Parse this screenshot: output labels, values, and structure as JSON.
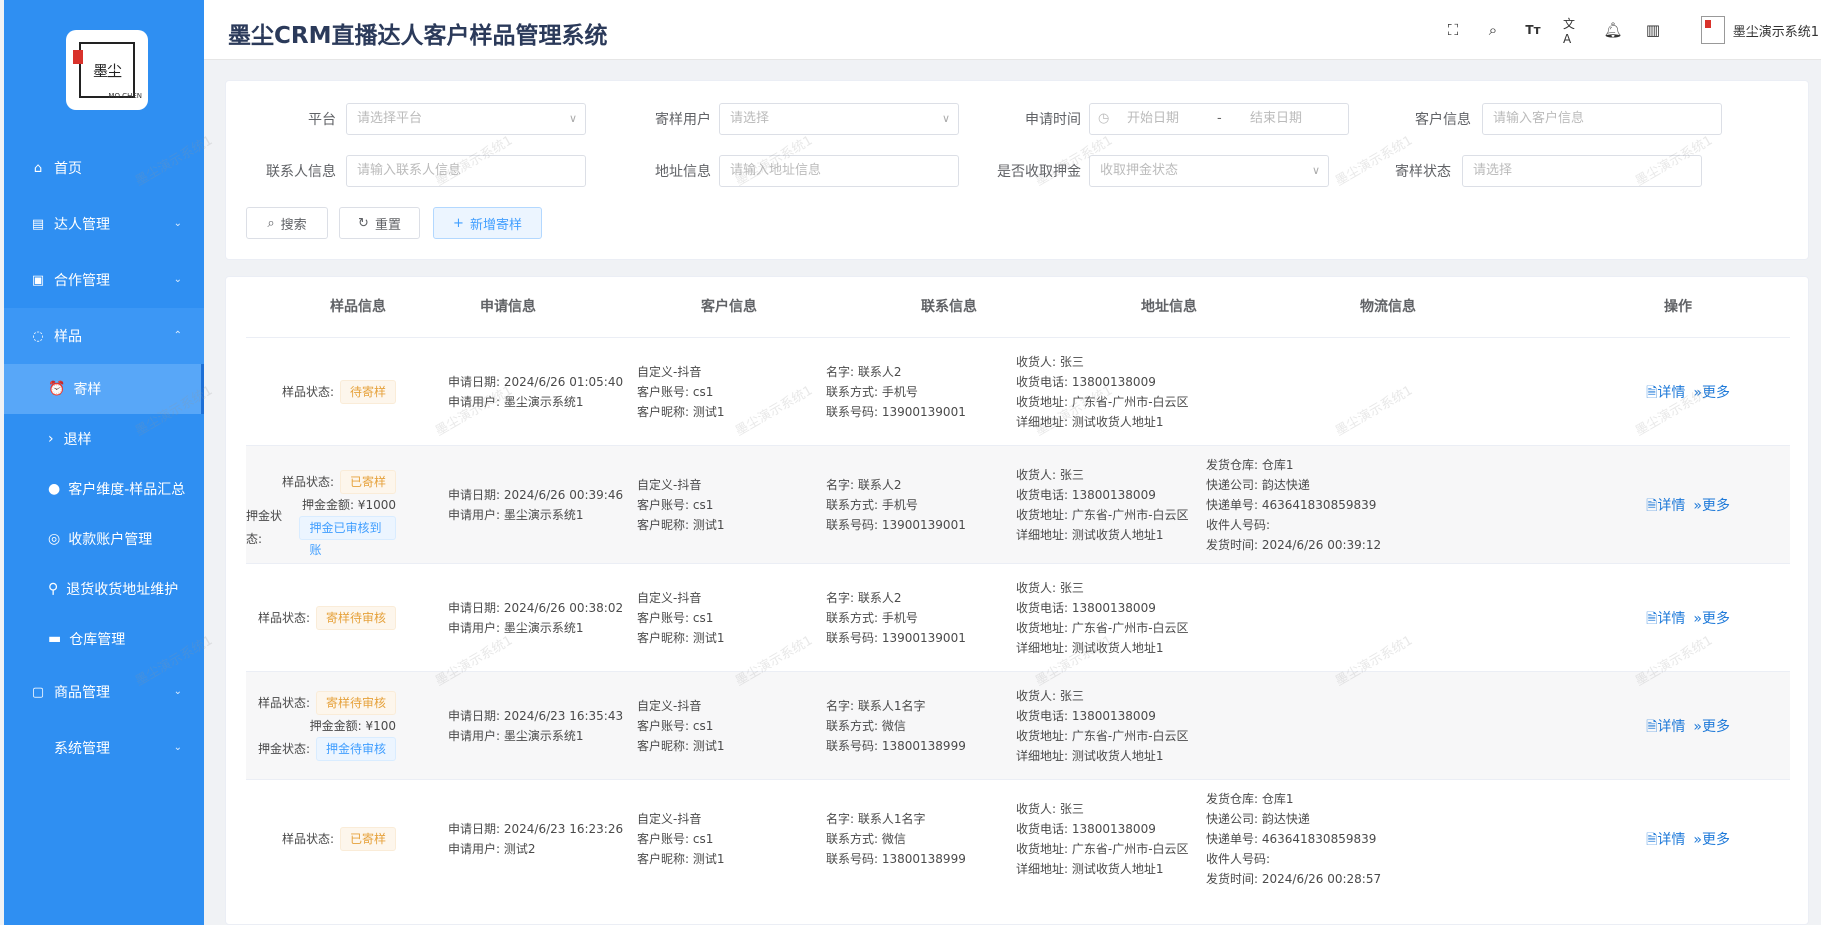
{
  "app_title": "墨尘CRM直播达人客户样品管理系统",
  "user_name": "墨尘演示系统1",
  "logo": {
    "char": "墨尘",
    "sub": "MO CHEN"
  },
  "watermark": "墨尘演示系统1",
  "sidebar": {
    "items": [
      {
        "label": "首页",
        "icon": "home-icon"
      },
      {
        "label": "达人管理",
        "icon": "id-card-icon"
      },
      {
        "label": "合作管理",
        "icon": "briefcase-icon"
      },
      {
        "label": "样品",
        "icon": "apple-icon"
      },
      {
        "label": "寄样",
        "icon": "alarm-clock-icon"
      },
      {
        "label": "退样",
        "icon": "chevron-right-icon"
      },
      {
        "label": "客户维度-样品汇总",
        "icon": "user-icon"
      },
      {
        "label": "收款账户管理",
        "icon": "compass-icon"
      },
      {
        "label": "退货收货地址维护",
        "icon": "bicycle-icon"
      },
      {
        "label": "仓库管理",
        "icon": "suitcase-icon"
      },
      {
        "label": "商品管理",
        "icon": "box-icon"
      },
      {
        "label": "系统管理",
        "icon": ""
      }
    ]
  },
  "filters": {
    "platform_label": "平台",
    "platform_ph": "请选择平台",
    "sender_label": "寄样用户",
    "sender_ph": "请选择",
    "apply_time_label": "申请时间",
    "start_ph": "开始日期",
    "sep": "-",
    "end_ph": "结束日期",
    "customer_label": "客户信息",
    "customer_ph": "请输入客户信息",
    "contact_label": "联系人信息",
    "contact_ph": "请输入联系人信息",
    "address_label": "地址信息",
    "address_ph": "请输入地址信息",
    "deposit_label": "是否收取押金",
    "deposit_ph": "收取押金状态",
    "status_label": "寄样状态",
    "status_ph": "请选择",
    "search_btn": "搜索",
    "reset_btn": "重置",
    "add_btn": "新增寄样"
  },
  "table": {
    "headers": [
      "样品信息",
      "申请信息",
      "客户信息",
      "联系信息",
      "地址信息",
      "物流信息",
      "操作"
    ],
    "detail_label": "详情",
    "more_label": "更多",
    "rows": [
      {
        "sample": [
          [
            "样品状态:",
            "待寄样",
            "warn"
          ]
        ],
        "apply": [
          "申请日期: 2024/6/26 01:05:40",
          "申请用户: 墨尘演示系统1"
        ],
        "customer": [
          "自定义-抖音",
          "客户账号: cs1",
          "客户昵称: 测试1"
        ],
        "contact": [
          "名字: 联系人2",
          "联系方式: 手机号",
          "联系号码: 13900139001"
        ],
        "address": [
          "收货人: 张三",
          "收货电话: 13800138009",
          "收货地址: 广东省-广州市-白云区",
          "详细地址: 测试收货人地址1"
        ],
        "logistics": []
      },
      {
        "sample": [
          [
            "样品状态:",
            "已寄样",
            "warn"
          ],
          [
            "押金金额: ¥1000",
            "",
            ""
          ],
          [
            "押金状态:",
            "押金已审核到账",
            "info"
          ]
        ],
        "apply": [
          "申请日期: 2024/6/26 00:39:46",
          "申请用户: 墨尘演示系统1"
        ],
        "customer": [
          "自定义-抖音",
          "客户账号: cs1",
          "客户昵称: 测试1"
        ],
        "contact": [
          "名字: 联系人2",
          "联系方式: 手机号",
          "联系号码: 13900139001"
        ],
        "address": [
          "收货人: 张三",
          "收货电话: 13800138009",
          "收货地址: 广东省-广州市-白云区",
          "详细地址: 测试收货人地址1"
        ],
        "logistics": [
          "发货仓库: 仓库1",
          "快递公司: 韵达快递",
          "快递单号: 463641830859839",
          "收件人号码:",
          "发货时间: 2024/6/26 00:39:12"
        ]
      },
      {
        "sample": [
          [
            "样品状态:",
            "寄样待审核",
            "warn"
          ]
        ],
        "apply": [
          "申请日期: 2024/6/26 00:38:02",
          "申请用户: 墨尘演示系统1"
        ],
        "customer": [
          "自定义-抖音",
          "客户账号: cs1",
          "客户昵称: 测试1"
        ],
        "contact": [
          "名字: 联系人2",
          "联系方式: 手机号",
          "联系号码: 13900139001"
        ],
        "address": [
          "收货人: 张三",
          "收货电话: 13800138009",
          "收货地址: 广东省-广州市-白云区",
          "详细地址: 测试收货人地址1"
        ],
        "logistics": []
      },
      {
        "sample": [
          [
            "样品状态:",
            "寄样待审核",
            "warn"
          ],
          [
            "押金金额: ¥100",
            "",
            ""
          ],
          [
            "押金状态:",
            "押金待审核",
            "info"
          ]
        ],
        "apply": [
          "申请日期: 2024/6/23 16:35:43",
          "申请用户: 墨尘演示系统1"
        ],
        "customer": [
          "自定义-抖音",
          "客户账号: cs1",
          "客户昵称: 测试1"
        ],
        "contact": [
          "名字: 联系人1名字",
          "联系方式: 微信",
          "联系号码: 13800138999"
        ],
        "address": [
          "收货人: 张三",
          "收货电话: 13800138009",
          "收货地址: 广东省-广州市-白云区",
          "详细地址: 测试收货人地址1"
        ],
        "logistics": []
      },
      {
        "sample": [
          [
            "样品状态:",
            "已寄样",
            "warn"
          ]
        ],
        "apply": [
          "申请日期: 2024/6/23 16:23:26",
          "申请用户: 测试2"
        ],
        "customer": [
          "自定义-抖音",
          "客户账号: cs1",
          "客户昵称: 测试1"
        ],
        "contact": [
          "名字: 联系人1名字",
          "联系方式: 微信",
          "联系号码: 13800138999"
        ],
        "address": [
          "收货人: 张三",
          "收货电话: 13800138009",
          "收货地址: 广东省-广州市-白云区",
          "详细地址: 测试收货人地址1"
        ],
        "logistics": [
          "发货仓库: 仓库1",
          "快递公司: 韵达快递",
          "快递单号: 463641830859839",
          "收件人号码:",
          "发货时间: 2024/6/26 00:28:57"
        ]
      }
    ]
  }
}
